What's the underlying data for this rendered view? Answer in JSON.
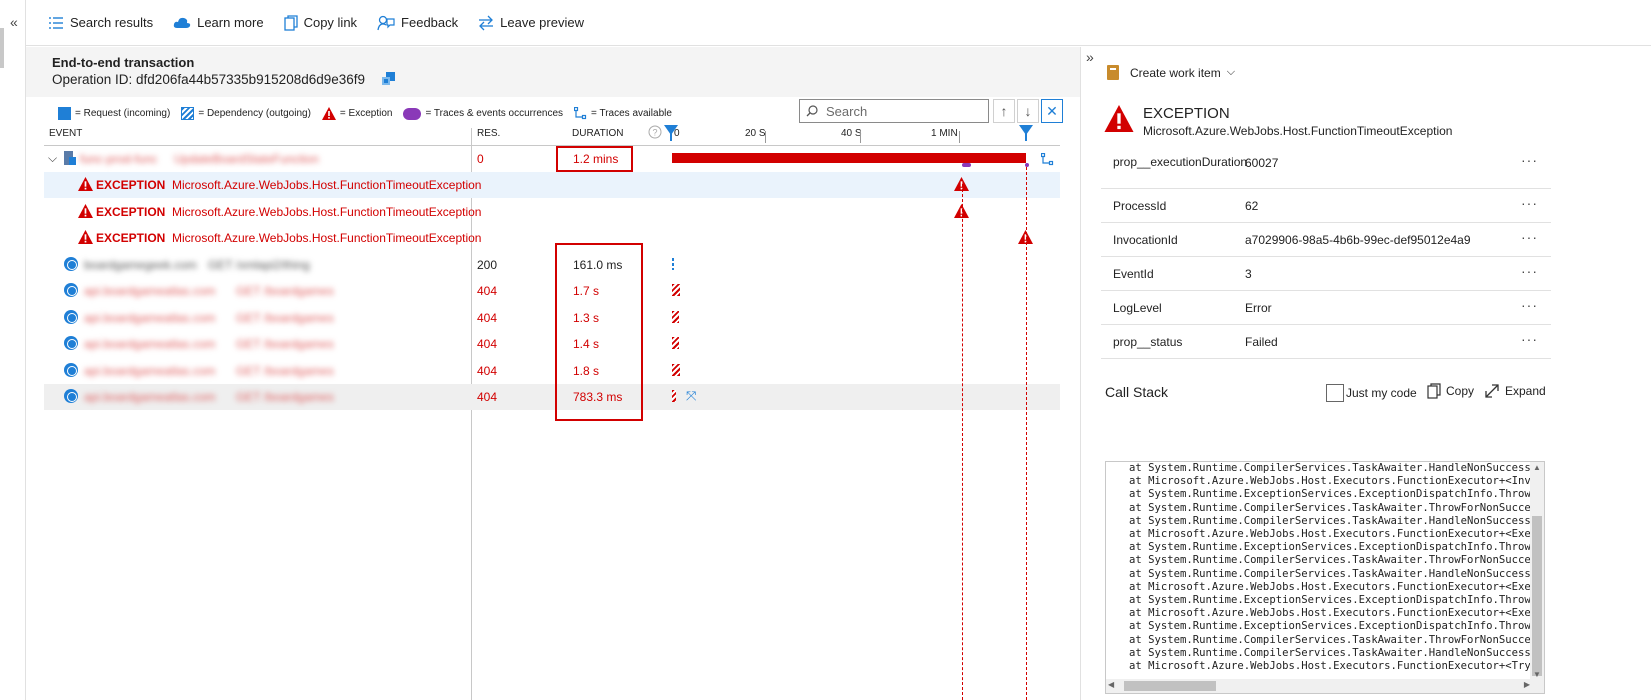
{
  "toolbar": {
    "search_results": "Search results",
    "learn_more": "Learn more",
    "copy_link": "Copy link",
    "feedback": "Feedback",
    "leave_preview": "Leave preview"
  },
  "transaction": {
    "title": "End-to-end transaction",
    "operation_id": "Operation ID: dfd206fa44b57335b915208d6d9e36f9"
  },
  "legend": {
    "request": "= Request (incoming)",
    "dependency": "= Dependency (outgoing)",
    "exception": "= Exception",
    "traces": "= Traces & events occurrences",
    "traces_available": "= Traces available"
  },
  "search": {
    "placeholder": "Search"
  },
  "columns": {
    "event": "EVENT",
    "res": "RES.",
    "duration": "DURATION"
  },
  "timeline_ticks": [
    "0",
    "20 S",
    "40 S",
    "1 MIN"
  ],
  "rows": [
    {
      "type": "request",
      "name": "func-prod-func",
      "detail": "UpdateBoardStateFunction",
      "res": "0",
      "duration": "1.2 mins",
      "fill_fraction": 1.0
    },
    {
      "type": "exception",
      "label": "EXCEPTION",
      "message": "Microsoft.Azure.WebJobs.Host.FunctionTimeoutException"
    },
    {
      "type": "exception",
      "label": "EXCEPTION",
      "message": "Microsoft.Azure.WebJobs.Host.FunctionTimeoutException"
    },
    {
      "type": "exception",
      "label": "EXCEPTION",
      "message": "Microsoft.Azure.WebJobs.Host.FunctionTimeoutException"
    },
    {
      "type": "dependency",
      "name": "boardgamegeek.com",
      "detail": "GET /xmlapi2/thing",
      "res": "200",
      "duration": "161.0 ms"
    },
    {
      "type": "dependency",
      "name": "api.boardgameatlas.com",
      "detail": "GET /boardgames",
      "res": "404",
      "duration": "1.7 s"
    },
    {
      "type": "dependency",
      "name": "api.boardgameatlas.com",
      "detail": "GET /boardgames",
      "res": "404",
      "duration": "1.3 s"
    },
    {
      "type": "dependency",
      "name": "api.boardgameatlas.com",
      "detail": "GET /boardgames",
      "res": "404",
      "duration": "1.4 s"
    },
    {
      "type": "dependency",
      "name": "api.boardgameatlas.com",
      "detail": "GET /boardgames",
      "res": "404",
      "duration": "1.8 s"
    },
    {
      "type": "dependency",
      "name": "api.boardgameatlas.com",
      "detail": "GET /boardgames",
      "res": "404",
      "duration": "783.3 ms"
    }
  ],
  "details": {
    "create_work_item": "Create work item",
    "exception_title": "EXCEPTION",
    "exception_type": "Microsoft.Azure.WebJobs.Host.FunctionTimeoutException",
    "properties": [
      {
        "key": "prop__executionDuration",
        "value": "60027"
      },
      {
        "key": "ProcessId",
        "value": "62"
      },
      {
        "key": "InvocationId",
        "value": "a7029906-98a5-4b6b-99ec-def95012e4a9"
      },
      {
        "key": "EventId",
        "value": "3"
      },
      {
        "key": "LogLevel",
        "value": "Error"
      },
      {
        "key": "prop__status",
        "value": "Failed"
      }
    ],
    "call_stack_title": "Call Stack",
    "just_my_code": "Just my code",
    "copy": "Copy",
    "expand": "Expand",
    "call_stack": [
      "at System.Runtime.CompilerServices.TaskAwaiter.HandleNonSuccessA",
      "at Microsoft.Azure.WebJobs.Host.Executors.FunctionExecutor+<Invo",
      "at System.Runtime.ExceptionServices.ExceptionDispatchInfo.Throw",
      "at System.Runtime.CompilerServices.TaskAwaiter.ThrowForNonSucces",
      "at System.Runtime.CompilerServices.TaskAwaiter.HandleNonSuccessA",
      "at Microsoft.Azure.WebJobs.Host.Executors.FunctionExecutor+<Exec",
      "at System.Runtime.ExceptionServices.ExceptionDispatchInfo.Throw",
      "at System.Runtime.CompilerServices.TaskAwaiter.ThrowForNonSucces",
      "at System.Runtime.CompilerServices.TaskAwaiter.HandleNonSuccessA",
      "at Microsoft.Azure.WebJobs.Host.Executors.FunctionExecutor+<Exec",
      "at System.Runtime.ExceptionServices.ExceptionDispatchInfo.Throw",
      "at Microsoft.Azure.WebJobs.Host.Executors.FunctionExecutor+<Exec",
      "at System.Runtime.ExceptionServices.ExceptionDispatchInfo.Throw",
      "at System.Runtime.CompilerServices.TaskAwaiter.ThrowForNonSucces",
      "at System.Runtime.CompilerServices.TaskAwaiter.HandleNonSuccessA",
      "at Microsoft.Azure.WebJobs.Host.Executors.FunctionExecutor+<TryE"
    ]
  },
  "colors": {
    "error": "#d20000",
    "accent": "#1f7fd6",
    "trace": "#8a39b8"
  }
}
